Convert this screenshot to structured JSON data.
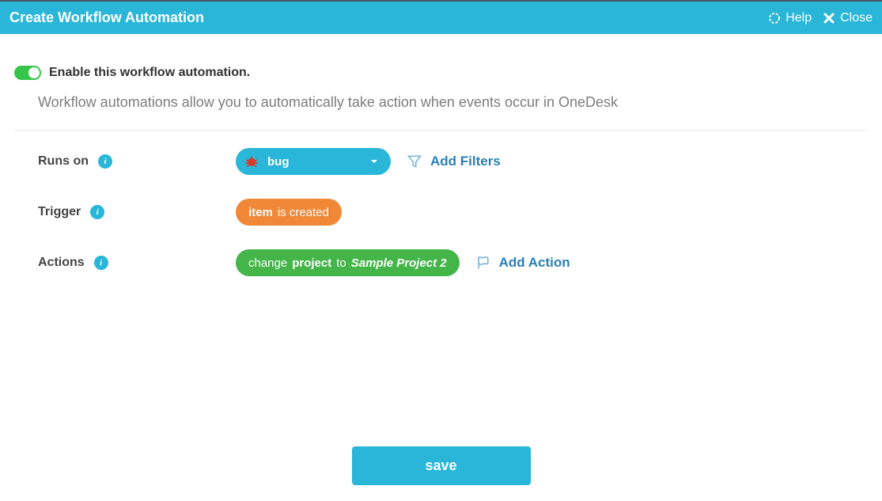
{
  "header": {
    "title": "Create Workflow Automation",
    "help_label": "Help",
    "close_label": "Close"
  },
  "enable": {
    "label": "Enable this workflow automation.",
    "on": true
  },
  "description": "Workflow automations allow you to automatically take action when events occur in OneDesk",
  "runs_on": {
    "label": "Runs on",
    "selected": "bug",
    "add_filters_label": "Add Filters"
  },
  "trigger": {
    "label": "Trigger",
    "subject": "item",
    "predicate": "is created"
  },
  "actions": {
    "label": "Actions",
    "verb": "change",
    "field": "project",
    "to_word": "to",
    "value": "Sample Project 2",
    "add_action_label": "Add Action"
  },
  "save_label": "save"
}
